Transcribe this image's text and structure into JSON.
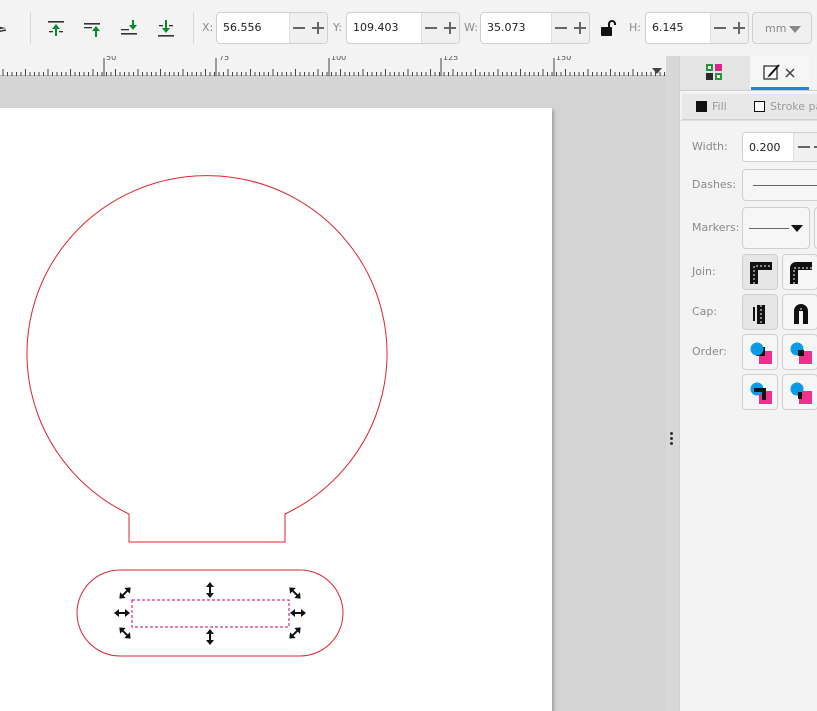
{
  "toolbar": {
    "x_label": "X:",
    "x_value": "56.556",
    "y_label": "Y:",
    "y_value": "109.403",
    "w_label": "W:",
    "w_value": "35.073",
    "h_label": "H:",
    "h_value": "6.145",
    "unit": "mm"
  },
  "ruler": {
    "labels": [
      "50",
      "75",
      "100",
      "125",
      "150"
    ]
  },
  "panel": {
    "tabs": [
      "swatches",
      "fill-and-stroke"
    ],
    "fill_tab": "Fill",
    "stroke_paint_tab": "Stroke pa",
    "width_label": "Width:",
    "width_value": "0.200",
    "dashes_label": "Dashes:",
    "markers_label": "Markers:",
    "join_label": "Join:",
    "cap_label": "Cap:",
    "order_label": "Order:"
  },
  "colors": {
    "path_stroke": "#e0242b",
    "selection_cue": "#c8007a",
    "accent": "#2f7fd6",
    "order_blue": "#0b9be6",
    "order_pink": "#f0308c"
  }
}
